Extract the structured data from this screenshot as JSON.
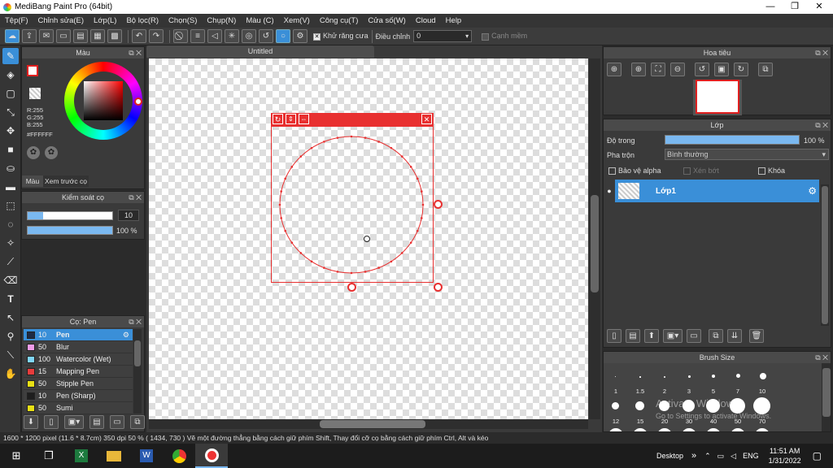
{
  "app": {
    "title": "MediBang Paint Pro (64bit)"
  },
  "window_controls": {
    "minimize": "—",
    "maximize": "❐",
    "close": "✕"
  },
  "menu": [
    "Tệp(F)",
    "Chỉnh sửa(E)",
    "Lớp(L)",
    "Bộ lọc(R)",
    "Chọn(S)",
    "Chụp(N)",
    "Màu (C)",
    "Xem(V)",
    "Công cụ(T)",
    "Cửa số(W)",
    "Cloud",
    "Help"
  ],
  "toolbar": {
    "antialias_label": "Khử răng cưa",
    "antialias_check": "✕",
    "correction_label": "Điều chỉnh",
    "correction_value": "0",
    "snap_label": "Cạnh mềm"
  },
  "color_panel": {
    "title": "Màu",
    "r": "R:255",
    "g": "G:255",
    "b": "B:255",
    "hex": "#FFFFFF",
    "tab_color": "Màu",
    "tab_preview": "Xem trước cọ"
  },
  "brush_control": {
    "title": "Kiểm soát cọ",
    "size": "10",
    "opacity": "100 %",
    "opacity_fraction": 1.0
  },
  "brush_list": {
    "title": "Cọ: Pen",
    "items": [
      {
        "size": "10",
        "name": "Pen",
        "color": "#1e2b45",
        "selected": true
      },
      {
        "size": "50",
        "name": "Blur",
        "color": "#f09ce8"
      },
      {
        "size": "100",
        "name": "Watercolor (Wet)",
        "color": "#7fd6f7"
      },
      {
        "size": "15",
        "name": "Mapping Pen",
        "color": "#e83c3c"
      },
      {
        "size": "50",
        "name": "Stipple Pen",
        "color": "#e8e015"
      },
      {
        "size": "10",
        "name": "Pen (Sharp)",
        "color": "#1e1e1e"
      },
      {
        "size": "50",
        "name": "Sumi",
        "color": "#e8e015"
      }
    ]
  },
  "canvas": {
    "tab_title": "Untitled"
  },
  "navigator": {
    "title": "Hoa tiêu"
  },
  "layer_panel": {
    "title": "Lớp",
    "opacity_label": "Độ trong",
    "opacity_value": "100 %",
    "opacity_fraction": 1.0,
    "blend_label": "Pha trộn",
    "blend_value": "Bình thường",
    "protect_alpha": "Bảo vệ alpha",
    "clipping": "Xén bớt",
    "lock": "Khóa",
    "layers": [
      {
        "name": "Lớp1"
      }
    ]
  },
  "brush_size_panel": {
    "title": "Brush Size",
    "sizes_row1": [
      "1",
      "1.5",
      "2",
      "3",
      "5",
      "7",
      "10"
    ],
    "sizes_row2": [
      "12",
      "15",
      "20",
      "30",
      "40",
      "50",
      "70"
    ]
  },
  "watermark": {
    "line1": "Activate Windows",
    "line2": "Go to Settings to activate Windows."
  },
  "status": {
    "text": "1600 * 1200 pixel  (11.6 * 8.7cm)  350 dpi  50 %  ( 1434, 730 )  Vẽ một đường thẳng bằng cách giữ phím Shift, Thay đổi cỡ cọ bằng cách giữ phím Ctrl, Alt và kéo"
  },
  "taskbar": {
    "desktop": "Desktop",
    "lang": "ENG",
    "time": "11:51 AM",
    "date": "1/31/2022",
    "chevron": "»",
    "tray_up": "⌃"
  },
  "colors": {
    "accent": "#3a8fd8",
    "selection": "#e83030"
  }
}
